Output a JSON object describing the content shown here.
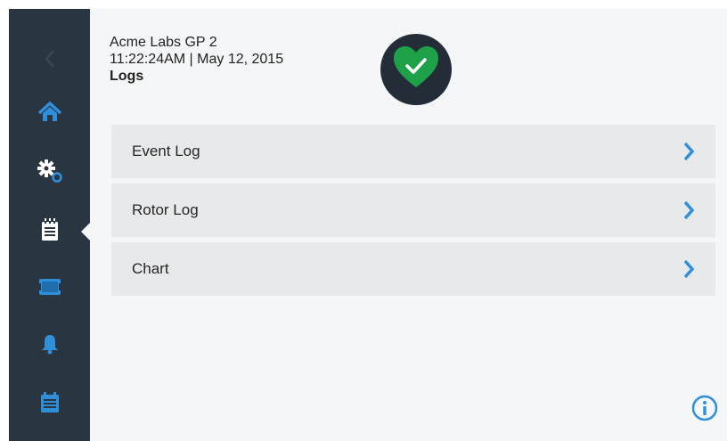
{
  "header": {
    "device_name": "Acme Labs GP 2",
    "datetime": "11:22:24AM | May 12, 2015",
    "page_title": "Logs"
  },
  "status": {
    "icon": "heart-check-icon",
    "state": "ok",
    "color": "#1fa14a"
  },
  "sidebar": {
    "items": [
      {
        "name": "back",
        "icon": "chevron-left-icon",
        "active": false
      },
      {
        "name": "home",
        "icon": "home-icon",
        "active": false
      },
      {
        "name": "settings",
        "icon": "gears-icon",
        "active": false
      },
      {
        "name": "logs",
        "icon": "notepad-icon",
        "active": true
      },
      {
        "name": "display",
        "icon": "screen-icon",
        "active": false
      },
      {
        "name": "alarms",
        "icon": "bell-icon",
        "active": false
      },
      {
        "name": "calendar",
        "icon": "calendar-icon",
        "active": false
      }
    ]
  },
  "menu": {
    "items": [
      {
        "label": "Event Log",
        "icon": "chevron-right-icon"
      },
      {
        "label": "Rotor Log",
        "icon": "chevron-right-icon"
      },
      {
        "label": "Chart",
        "icon": "chevron-right-icon"
      }
    ]
  },
  "info": {
    "icon": "info-icon"
  },
  "colors": {
    "sidebar_bg": "#2a3542",
    "accent": "#2f8fd8",
    "content_bg": "#f5f6f7",
    "row_bg": "#e8e9ea",
    "status_bg": "#222d38"
  }
}
